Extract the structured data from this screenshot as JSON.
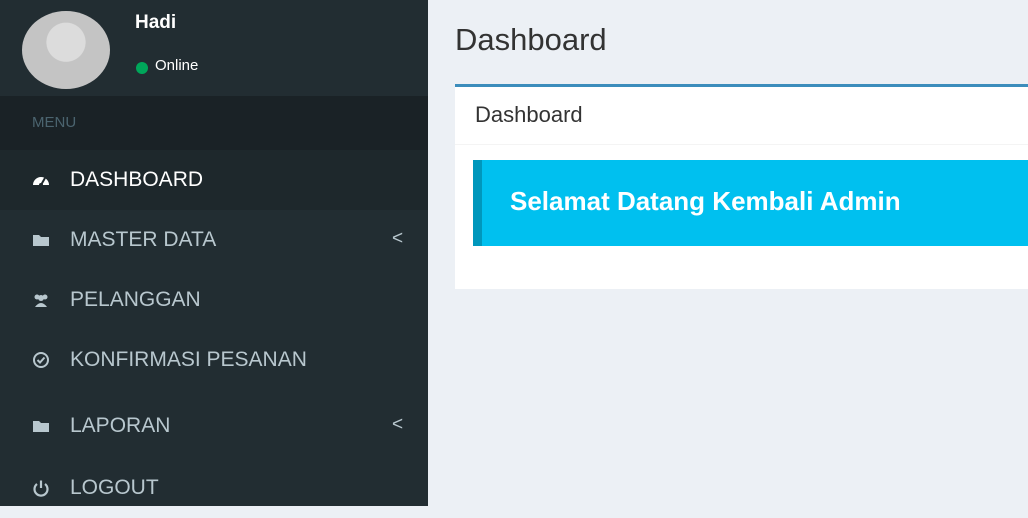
{
  "user": {
    "name": "Hadi",
    "status": "Online"
  },
  "sidebar": {
    "menu_header": "MENU",
    "items": [
      {
        "label": "DASHBOARD",
        "icon": "dashboard-icon",
        "active": true
      },
      {
        "label": "MASTER DATA",
        "icon": "folder-icon",
        "chevron": "<"
      },
      {
        "label": "PELANGGAN",
        "icon": "users-icon"
      },
      {
        "label": "KONFIRMASI PESANAN",
        "icon": "check-circle-icon"
      },
      {
        "label": "LAPORAN",
        "icon": "folder-icon",
        "chevron": "<"
      },
      {
        "label": "LOGOUT",
        "icon": "power-icon"
      }
    ]
  },
  "content": {
    "header": "Dashboard",
    "box_title": "Dashboard",
    "callout_text": "Selamat Datang Kembali Admin"
  },
  "colors": {
    "sidebar_bg": "#222d32",
    "content_bg": "#ecf0f5",
    "callout_bg": "#00c0ef",
    "status_online": "#00a65a"
  }
}
